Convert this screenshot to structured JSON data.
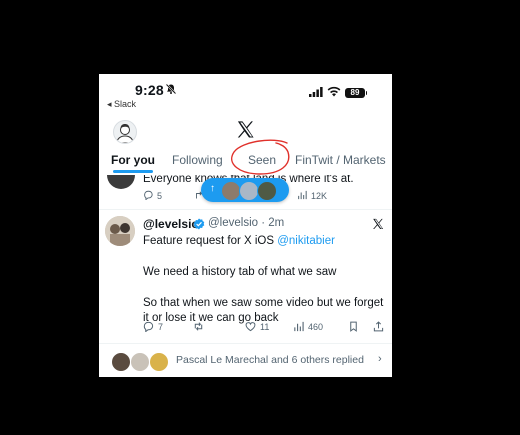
{
  "status_bar": {
    "time": "9:28",
    "back_app": "◂ Slack",
    "battery": "89"
  },
  "tabs": [
    "For you",
    "Following",
    "Seen",
    "FinTwit / Markets"
  ],
  "previous_tweet": {
    "text": "Everyone knows that land is where it's at.",
    "replies": "5",
    "likes": "12K"
  },
  "tweet": {
    "name": "@levelsio",
    "handle_time": "@levelsio · 2m",
    "line1_prefix": "Feature request for X iOS ",
    "line1_mention": "@nikitabier",
    "para2": "We need a history tab of what we saw",
    "para3": "So that when we saw some video but we forget it or lose it we can go back",
    "replies": "7",
    "likes": "11",
    "views": "460"
  },
  "replies_row": {
    "text": "Pascal Le Marechal and 6 others replied",
    "chevron": "›"
  },
  "colors": {
    "accent": "#1d9bf0",
    "annotation": "#e0312b"
  }
}
